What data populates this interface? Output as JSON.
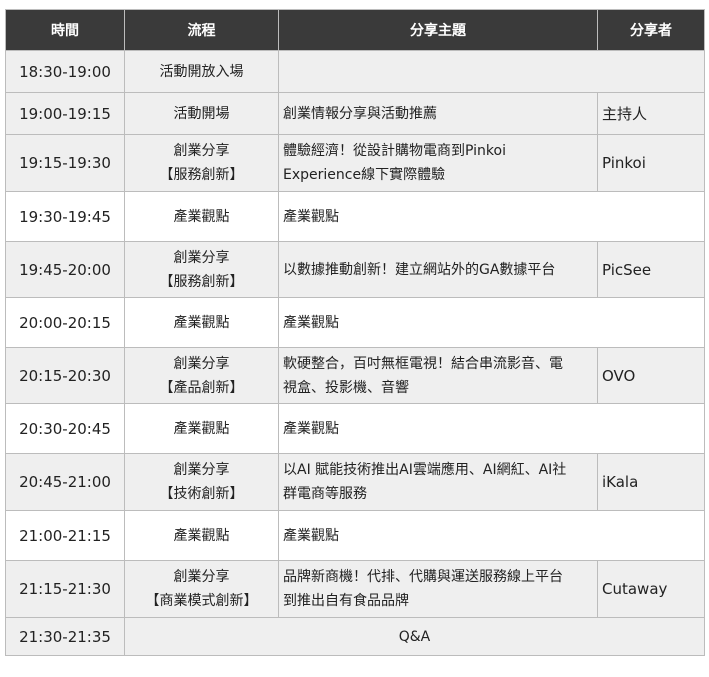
{
  "headers": {
    "time": "時間",
    "flow": "流程",
    "topic": "分享主題",
    "speaker": "分享者"
  },
  "rows": [
    {
      "time": "18:30-19:00",
      "flow": [
        "活動開放入場"
      ],
      "topic": [],
      "speaker": "",
      "type": "span-empty"
    },
    {
      "time": "19:00-19:15",
      "flow": [
        "活動開場"
      ],
      "topic": [
        "創業情報分享與活動推薦"
      ],
      "speaker": "主持人",
      "type": "normal"
    },
    {
      "time": "19:15-19:30",
      "flow": [
        "創業分享",
        "【服務創新】"
      ],
      "topic": [
        "體驗經濟！從設計購物電商到Pinkoi",
        "Experience線下實際體驗"
      ],
      "speaker": "Pinkoi",
      "type": "normal"
    },
    {
      "time": "19:30-19:45",
      "flow": [
        "產業觀點"
      ],
      "topic": [
        "產業觀點"
      ],
      "speaker": "",
      "type": "topic-span"
    },
    {
      "time": "19:45-20:00",
      "flow": [
        "創業分享",
        "【服務創新】"
      ],
      "topic": [
        "以數據推動創新！建立網站外的GA數據平台"
      ],
      "speaker": "PicSee",
      "type": "normal"
    },
    {
      "time": "20:00-20:15",
      "flow": [
        "產業觀點"
      ],
      "topic": [
        "產業觀點"
      ],
      "speaker": "",
      "type": "topic-span"
    },
    {
      "time": "20:15-20:30",
      "flow": [
        "創業分享",
        "【產品創新】"
      ],
      "topic": [
        "軟硬整合，百吋無框電視！結合串流影音、電",
        "視盒、投影機、音響"
      ],
      "speaker": "OVO",
      "type": "normal"
    },
    {
      "time": "20:30-20:45",
      "flow": [
        "產業觀點"
      ],
      "topic": [
        "產業觀點"
      ],
      "speaker": "",
      "type": "topic-span"
    },
    {
      "time": "20:45-21:00",
      "flow": [
        "創業分享",
        "【技術創新】"
      ],
      "topic": [
        "以AI 賦能技術推出AI雲端應用、AI網紅、AI社",
        "群電商等服務"
      ],
      "speaker": "iKala",
      "type": "normal"
    },
    {
      "time": "21:00-21:15",
      "flow": [
        "產業觀點"
      ],
      "topic": [
        "產業觀點"
      ],
      "speaker": "",
      "type": "topic-span"
    },
    {
      "time": "21:15-21:30",
      "flow": [
        "創業分享",
        "【商業模式創新】"
      ],
      "topic": [
        "品牌新商機！代排、代購與運送服務線上平台",
        "到推出自有食品品牌"
      ],
      "speaker": "Cutaway",
      "type": "normal"
    },
    {
      "time": "21:30-21:35",
      "flow": [
        "Q&A"
      ],
      "topic": [],
      "speaker": "",
      "type": "full-span"
    }
  ]
}
